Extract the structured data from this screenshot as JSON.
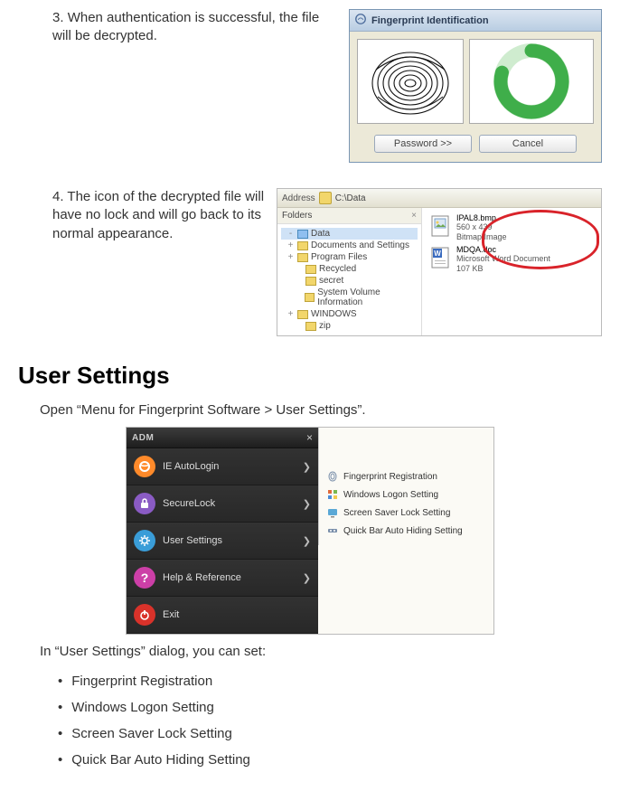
{
  "steps": {
    "s3": {
      "num": "3.",
      "text": "When authentication is successful, the file will be decrypted."
    },
    "s4": {
      "num": "4.",
      "text": "The icon of the decrypted file will have no lock and will go back to its normal appearance."
    }
  },
  "fingerprint_dialog": {
    "title": "Fingerprint Identification",
    "password_btn": "Password >>",
    "cancel_btn": "Cancel"
  },
  "explorer": {
    "address_label": "Address",
    "address_value": "C:\\Data",
    "folders_label": "Folders",
    "tree": [
      {
        "toggle": "-",
        "name": "Data",
        "selected": true
      },
      {
        "toggle": "+",
        "name": "Documents and Settings"
      },
      {
        "toggle": "+",
        "name": "Program Files"
      },
      {
        "toggle": "",
        "name": "Recycled"
      },
      {
        "toggle": "",
        "name": "secret"
      },
      {
        "toggle": "",
        "name": "System Volume Information"
      },
      {
        "toggle": "+",
        "name": "WINDOWS"
      },
      {
        "toggle": "",
        "name": "zip"
      }
    ],
    "files": [
      {
        "name": "IPAL8.bmp",
        "meta1": "560 x 439",
        "meta2": "Bitmap Image"
      },
      {
        "name": "MDQA.doc",
        "meta1": "Microsoft Word Document",
        "meta2": "107 KB"
      }
    ]
  },
  "section": {
    "heading": "User Settings",
    "open_text": "Open “Menu for Fingerprint Software > User Settings”.",
    "dialog_text": "In “User Settings” dialog, you can set:",
    "bullets": [
      "Fingerprint Registration",
      "Windows Logon Setting",
      "Screen Saver Lock Setting",
      "Quick Bar Auto Hiding Setting"
    ]
  },
  "menu": {
    "adm": "ADM",
    "close": "×",
    "items": [
      {
        "label": "IE AutoLogin",
        "icon_bg": "#ff8a2a",
        "glyph": "e"
      },
      {
        "label": "SecureLock",
        "icon_bg": "#8a5bc4",
        "glyph": "lock"
      },
      {
        "label": "User Settings",
        "icon_bg": "#3a9dd8",
        "glyph": "gear"
      },
      {
        "label": "Help & Reference",
        "icon_bg": "#cc3fa7",
        "glyph": "?"
      },
      {
        "label": "Exit",
        "icon_bg": "#d9322a",
        "glyph": "power"
      }
    ],
    "sub_items": [
      "Fingerprint Registration",
      "Windows Logon Setting",
      "Screen Saver Lock Setting",
      "Quick Bar Auto Hiding Setting"
    ]
  }
}
